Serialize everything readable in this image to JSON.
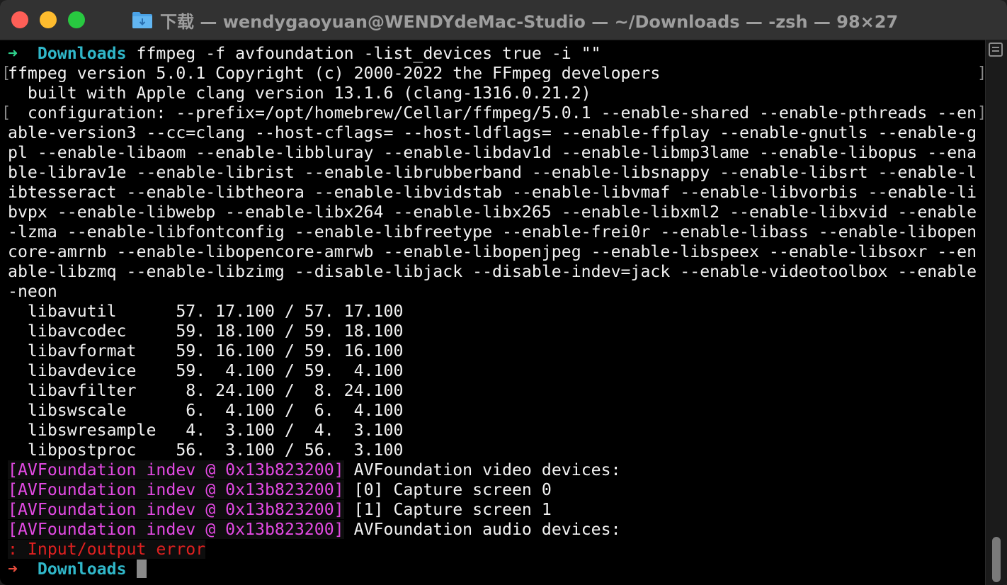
{
  "window": {
    "title": "下载 — wendygaoyuan@WENDYdeMac-Studio — ~/Downloads — -zsh — 98×27",
    "folder_icon": "folder-icon"
  },
  "prompt": {
    "arrow": "➜",
    "directory": "Downloads",
    "command": " ffmpeg -f avfoundation -list_devices true -i \"\""
  },
  "output": {
    "lines": [
      "ffmpeg version 5.0.1 Copyright (c) 2000-2022 the FFmpeg developers",
      "  built with Apple clang version 13.1.6 (clang-1316.0.21.2)",
      "  configuration: --prefix=/opt/homebrew/Cellar/ffmpeg/5.0.1 --enable-shared --enable-pthreads --en",
      "able-version3 --cc=clang --host-cflags= --host-ldflags= --enable-ffplay --enable-gnutls --enable-g",
      "pl --enable-libaom --enable-libbluray --enable-libdav1d --enable-libmp3lame --enable-libopus --ena",
      "ble-librav1e --enable-librist --enable-librubberband --enable-libsnappy --enable-libsrt --enable-l",
      "ibtesseract --enable-libtheora --enable-libvidstab --enable-libvmaf --enable-libvorbis --enable-li",
      "bvpx --enable-libwebp --enable-libx264 --enable-libx265 --enable-libxml2 --enable-libxvid --enable",
      "-lzma --enable-libfontconfig --enable-libfreetype --enable-frei0r --enable-libass --enable-libopen",
      "core-amrnb --enable-libopencore-amrwb --enable-libopenjpeg --enable-libspeex --enable-libsoxr --en",
      "able-libzmq --enable-libzimg --disable-libjack --disable-indev=jack --enable-videotoolbox --enable",
      "-neon",
      "  libavutil      57. 17.100 / 57. 17.100",
      "  libavcodec     59. 18.100 / 59. 18.100",
      "  libavformat    59. 16.100 / 59. 16.100",
      "  libavdevice    59.  4.100 / 59.  4.100",
      "  libavfilter     8. 24.100 /  8. 24.100",
      "  libswscale      6.  4.100 /  6.  4.100",
      "  libswresample   4.  3.100 /  4.  3.100",
      "  libpostproc    56.  3.100 / 56.  3.100"
    ],
    "av_prefix": "[AVFoundation indev @ 0x13b823200]",
    "av_messages": [
      " AVFoundation video devices:",
      " [0] Capture screen 0",
      " [1] Capture screen 1",
      " AVFoundation audio devices:"
    ],
    "error": ": Input/output error"
  },
  "final_prompt": {
    "arrow": "➜",
    "directory": "Downloads"
  },
  "colors": {
    "prompt_success": "#2fd28d",
    "prompt_error": "#e74c3c",
    "directory": "#30b7c9",
    "av_prefix": "#e44ae4",
    "error_text": "#e02020"
  }
}
